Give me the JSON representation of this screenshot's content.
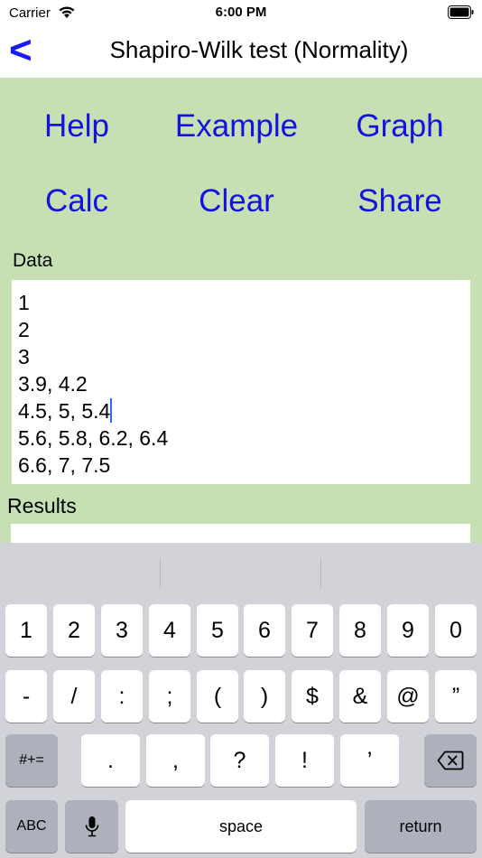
{
  "status": {
    "carrier": "Carrier",
    "time": "6:00 PM"
  },
  "nav": {
    "back": "<",
    "title": "Shapiro-Wilk test (Normality)"
  },
  "buttons": {
    "help": "Help",
    "example": "Example",
    "graph": "Graph",
    "calc": "Calc",
    "clear": "Clear",
    "share": "Share"
  },
  "data_label": "Data",
  "data_lines": [
    "1",
    "2",
    "3",
    "3.9, 4.2",
    "4.5, 5, 5.4",
    "5.6, 5.8, 6.2, 6.4",
    "6.6, 7, 7.5"
  ],
  "results_label": "Results",
  "keyboard": {
    "row1": [
      "1",
      "2",
      "3",
      "4",
      "5",
      "6",
      "7",
      "8",
      "9",
      "0"
    ],
    "row2": [
      "-",
      "/",
      ":",
      ";",
      "(",
      ")",
      "$",
      "&",
      "@",
      "”"
    ],
    "row3": [
      ".",
      ",",
      "?",
      "!",
      "’"
    ],
    "symbols_key": "#+=",
    "abc_key": "ABC",
    "space_key": "space",
    "return_key": "return"
  }
}
